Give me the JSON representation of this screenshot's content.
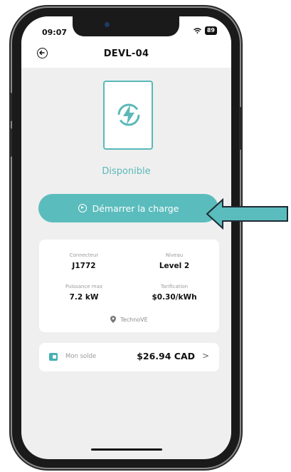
{
  "status_bar": {
    "time": "09:07",
    "battery": "89"
  },
  "header": {
    "title": "DEVL-04"
  },
  "station": {
    "status": "Disponible"
  },
  "start_button": {
    "label": "Démarrer la charge"
  },
  "info": {
    "connector_label": "Connecteur",
    "connector_value": "J1772",
    "level_label": "Niveau",
    "level_value": "Level 2",
    "power_label": "Puissance max",
    "power_value": "7.2 kW",
    "pricing_label": "Tarification",
    "pricing_value": "$0.30/kWh",
    "operator": "TechnoVE"
  },
  "balance": {
    "label": "Mon solde",
    "value": "$26.94 CAD",
    "chevron": ">"
  },
  "colors": {
    "accent": "#5bbcbd",
    "arrow": "#5bbcbd"
  },
  "icons": [
    "back-arrow-icon",
    "lightning-icon",
    "play-icon",
    "location-pin-icon",
    "wallet-icon",
    "chevron-right-icon",
    "wifi-icon",
    "battery-icon"
  ]
}
